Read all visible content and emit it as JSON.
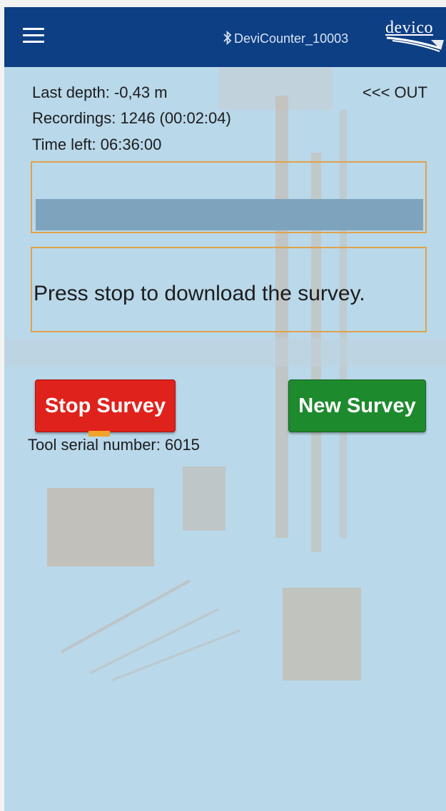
{
  "topbar": {
    "menu_icon": "hamburger-menu-icon",
    "bluetooth_icon": "bluetooth-icon",
    "device_name": "DeviCounter_10003",
    "logo_text": "devico",
    "background_color": "#0d3f84"
  },
  "status": {
    "last_depth": "Last depth: -0,43 m",
    "recordings": "Recordings: 1246 (00:02:04)",
    "time_left": "Time left: 06:36:00",
    "direction": "<<< OUT"
  },
  "progress": {
    "value": 1.0
  },
  "message": {
    "text": "Press stop to download the survey."
  },
  "buttons": {
    "stop_label": "Stop Survey",
    "stop_color": "#e0221c",
    "new_label": "New Survey",
    "new_color": "#1d8a2e"
  },
  "tool": {
    "serial_text": "Tool serial number: 6015"
  }
}
